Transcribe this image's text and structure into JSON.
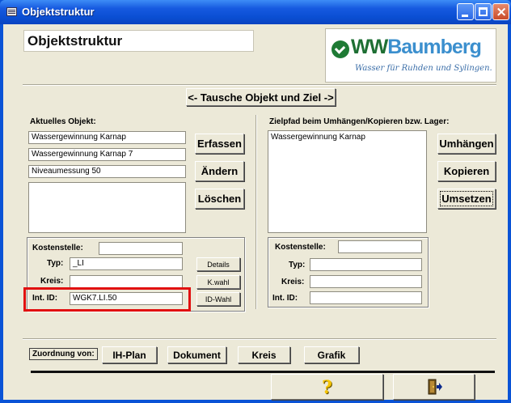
{
  "window": {
    "title": "Objektstruktur"
  },
  "header": {
    "title": "Objektstruktur"
  },
  "logo": {
    "brand_ww": "WW",
    "brand_rest": "Baumberg",
    "slogan": "Wasser für Ruhden und Sylingen."
  },
  "swap": {
    "label": "<- Tausche Objekt und Ziel ->"
  },
  "left": {
    "heading": "Aktuelles Objekt:",
    "fields": [
      "Wassergewinnung Karnap",
      "Wassergewinnung Karnap 7",
      "Niveaumessung 50"
    ],
    "buttons": {
      "erfassen": "Erfassen",
      "aendern": "Ändern",
      "loeschen": "Löschen"
    },
    "details": {
      "kostenstelle_label": "Kostenstelle:",
      "kostenstelle_value": "",
      "typ_label": "Typ:",
      "typ_value": "_LI",
      "kreis_label": "Kreis:",
      "kreis_value": "",
      "intid_label": "Int. ID:",
      "intid_value": "WGK7.LI.50"
    },
    "small_buttons": {
      "details": "Details",
      "kwahl": "K.wahl",
      "idwahl": "ID-Wahl"
    }
  },
  "right": {
    "heading": "Zielpfad beim Umhängen/Kopieren bzw. Lager:",
    "list": [
      "Wassergewinnung Karnap"
    ],
    "buttons": {
      "umhaengen": "Umhängen",
      "kopieren": "Kopieren",
      "umsetzen": "Umsetzen"
    },
    "details": {
      "kostenstelle_label": "Kostenstelle:",
      "kostenstelle_value": "",
      "typ_label": "Typ:",
      "typ_value": "",
      "kreis_label": "Kreis:",
      "kreis_value": "",
      "intid_label": "Int. ID:",
      "intid_value": ""
    }
  },
  "zuordnung": {
    "label": "Zuordnung von:",
    "buttons": [
      "IH-Plan",
      "Dokument",
      "Kreis",
      "Grafik"
    ]
  },
  "footer": {
    "help_glyph": "?",
    "help_icon": "question-icon",
    "exit_icon": "exit-door-icon"
  },
  "colors": {
    "titlebar": "#0a53d6",
    "client": "#ece9d8",
    "highlight": "#e11010",
    "brand_green": "#1e6f33",
    "brand_blue": "#3b8fce"
  }
}
